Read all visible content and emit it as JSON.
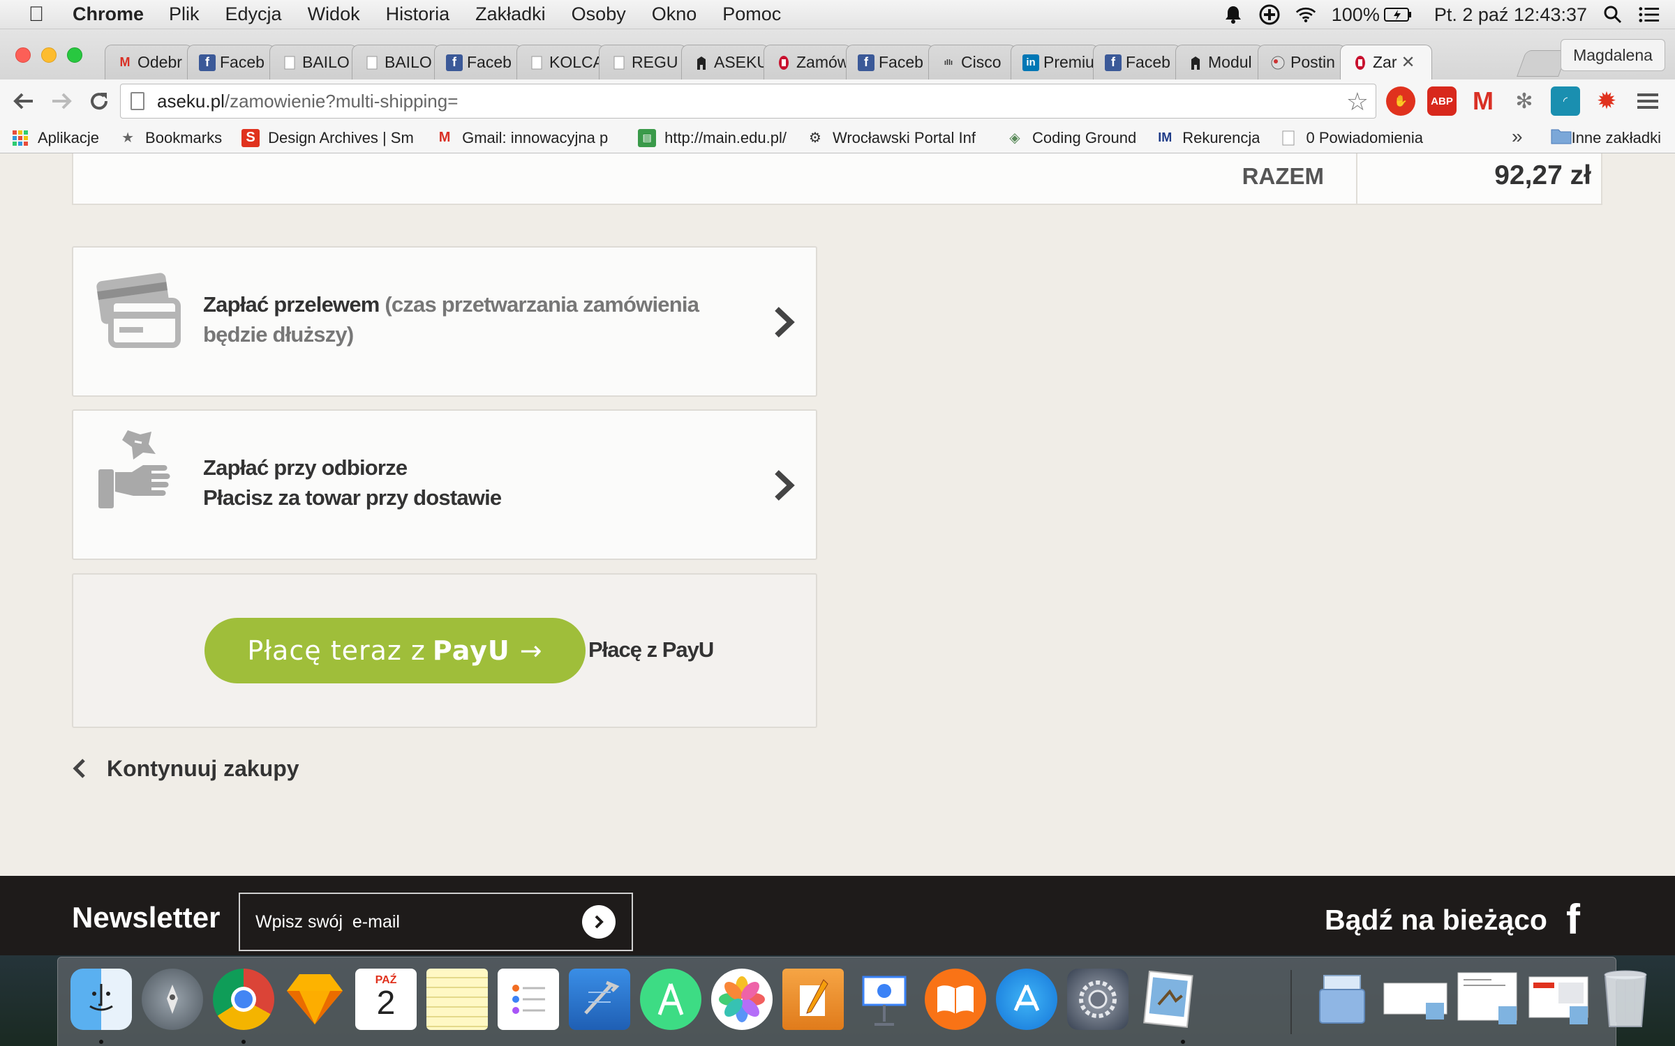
{
  "menubar": {
    "app": "Chrome",
    "items": [
      "Plik",
      "Edycja",
      "Widok",
      "Historia",
      "Zakładki",
      "Osoby",
      "Okno",
      "Pomoc"
    ],
    "battery": "100%",
    "datetime": "Pt. 2 paź  12:43:37"
  },
  "tabs": [
    {
      "label": "Odebr",
      "icon": "gmail-icon"
    },
    {
      "label": "Faceb",
      "icon": "facebook-icon"
    },
    {
      "label": "BAILO",
      "icon": "page-icon"
    },
    {
      "label": "BAILO",
      "icon": "page-icon"
    },
    {
      "label": "Faceb",
      "icon": "facebook-icon"
    },
    {
      "label": "KOLCA",
      "icon": "page-icon"
    },
    {
      "label": "REGU",
      "icon": "page-icon"
    },
    {
      "label": "ASEKU",
      "icon": "aseku-icon"
    },
    {
      "label": "Zamów",
      "icon": "aseku-red-icon"
    },
    {
      "label": "Faceb",
      "icon": "facebook-icon"
    },
    {
      "label": "Cisco",
      "icon": "cisco-icon"
    },
    {
      "label": "Premiu",
      "icon": "linkedin-icon"
    },
    {
      "label": "Faceb",
      "icon": "facebook-icon"
    },
    {
      "label": "Modul",
      "icon": "aseku-icon"
    },
    {
      "label": "Postin",
      "icon": "posting-icon"
    },
    {
      "label": "Zar",
      "icon": "aseku-red-icon",
      "active": true
    }
  ],
  "profile": "Magdalena",
  "omnibox": {
    "host": "aseku.pl",
    "path": "/zamowienie?multi-shipping="
  },
  "bookmarks": [
    {
      "label": "Aplikacje",
      "icon": "apps-grid-icon"
    },
    {
      "label": "Bookmarks",
      "icon": "star-icon"
    },
    {
      "label": "Design Archives | Sm",
      "icon": "design-archives-icon"
    },
    {
      "label": "Gmail: innowacyjna p",
      "icon": "gmail-icon"
    },
    {
      "label": "http://main.edu.pl/",
      "icon": "main-edu-icon"
    },
    {
      "label": "Wrocławski Portal Inf",
      "icon": "gear-icon"
    },
    {
      "label": "Coding Ground",
      "icon": "coding-ground-icon"
    },
    {
      "label": "Rekurencja",
      "icon": "im-icon"
    },
    {
      "label": "0 Powiadomienia",
      "icon": "page-icon"
    }
  ],
  "bookmarks_more": "»",
  "bookmarks_other": "Inne zakładki",
  "summary": {
    "label": "RAZEM",
    "value": "92,27 zł"
  },
  "payment": {
    "transfer": {
      "title": "Zapłać przelewem",
      "note": " (czas przetwarzania zamówienia będzie dłuższy)"
    },
    "cod": {
      "title": "Zapłać przy odbiorze",
      "subtitle": "Płacisz za towar przy dostawie"
    },
    "payu": {
      "button_prefix": "Płacę teraz z",
      "button_brand": "PayU",
      "button_arrow": "→",
      "label": "Płacę z PayU"
    }
  },
  "continue_label": "Kontynuuj zakupy",
  "footer": {
    "newsletter_title": "Newsletter",
    "email_placeholder": "Wpisz swój  e-mail",
    "stay_title": "Bądź na bieżąco",
    "facebook_glyph": "f"
  },
  "dock": [
    "finder-icon",
    "launchpad-icon",
    "chrome-icon",
    "sketch-icon",
    "calendar-icon",
    "notes-icon",
    "reminders-icon",
    "xcode-icon",
    "android-studio-icon",
    "photos-icon",
    "pages-icon",
    "keynote-icon",
    "ibooks-icon",
    "app-store-icon",
    "system-preferences-icon",
    "preview-icon",
    "folder-icon",
    "document-thumb-icon",
    "document-thumb-icon",
    "document-thumb-icon",
    "trash-icon"
  ],
  "calendar": {
    "month": "PAŹ",
    "day": "2"
  },
  "colors": {
    "payu_green": "#9fbe3a",
    "page_bg": "#f0ede7",
    "footer_bg": "#1e1b1a"
  }
}
